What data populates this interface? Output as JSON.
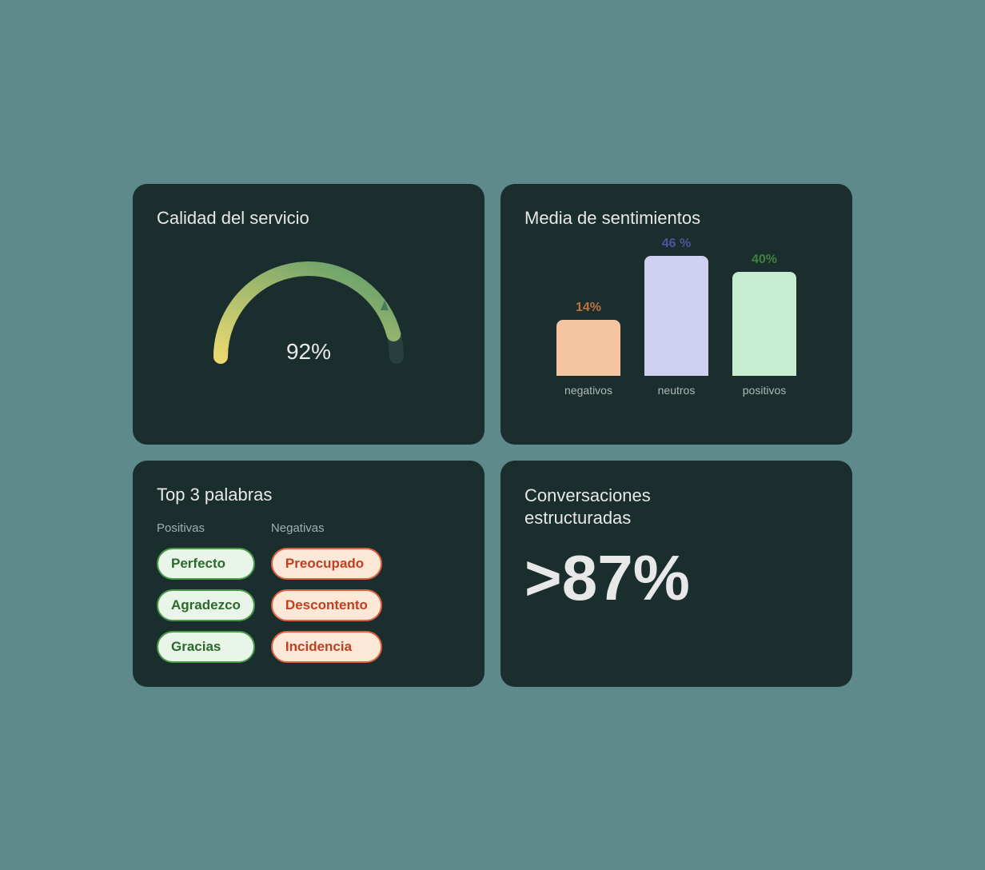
{
  "cards": {
    "service_quality": {
      "title": "Calidad del servicio",
      "value": "92%",
      "gauge_percent": 92
    },
    "sentiment_average": {
      "title": "Media de sentimientos",
      "bars": [
        {
          "label_bottom": "negativos",
          "label_top": "14%",
          "type": "negative"
        },
        {
          "label_bottom": "neutros",
          "label_top": "46 %",
          "type": "neutral"
        },
        {
          "label_bottom": "positivos",
          "label_top": "40%",
          "type": "positive"
        }
      ]
    },
    "top_words": {
      "title": "Top 3 palabras",
      "positive_header": "Positivas",
      "negative_header": "Negativas",
      "positive_words": [
        "Perfecto",
        "Agradezco",
        "Gracias"
      ],
      "negative_words": [
        "Preocupado",
        "Descontento",
        "Incidencia"
      ]
    },
    "conversations": {
      "title_line1": "Conversaciones",
      "title_line2": "estructuradas",
      "value": ">87%"
    }
  }
}
